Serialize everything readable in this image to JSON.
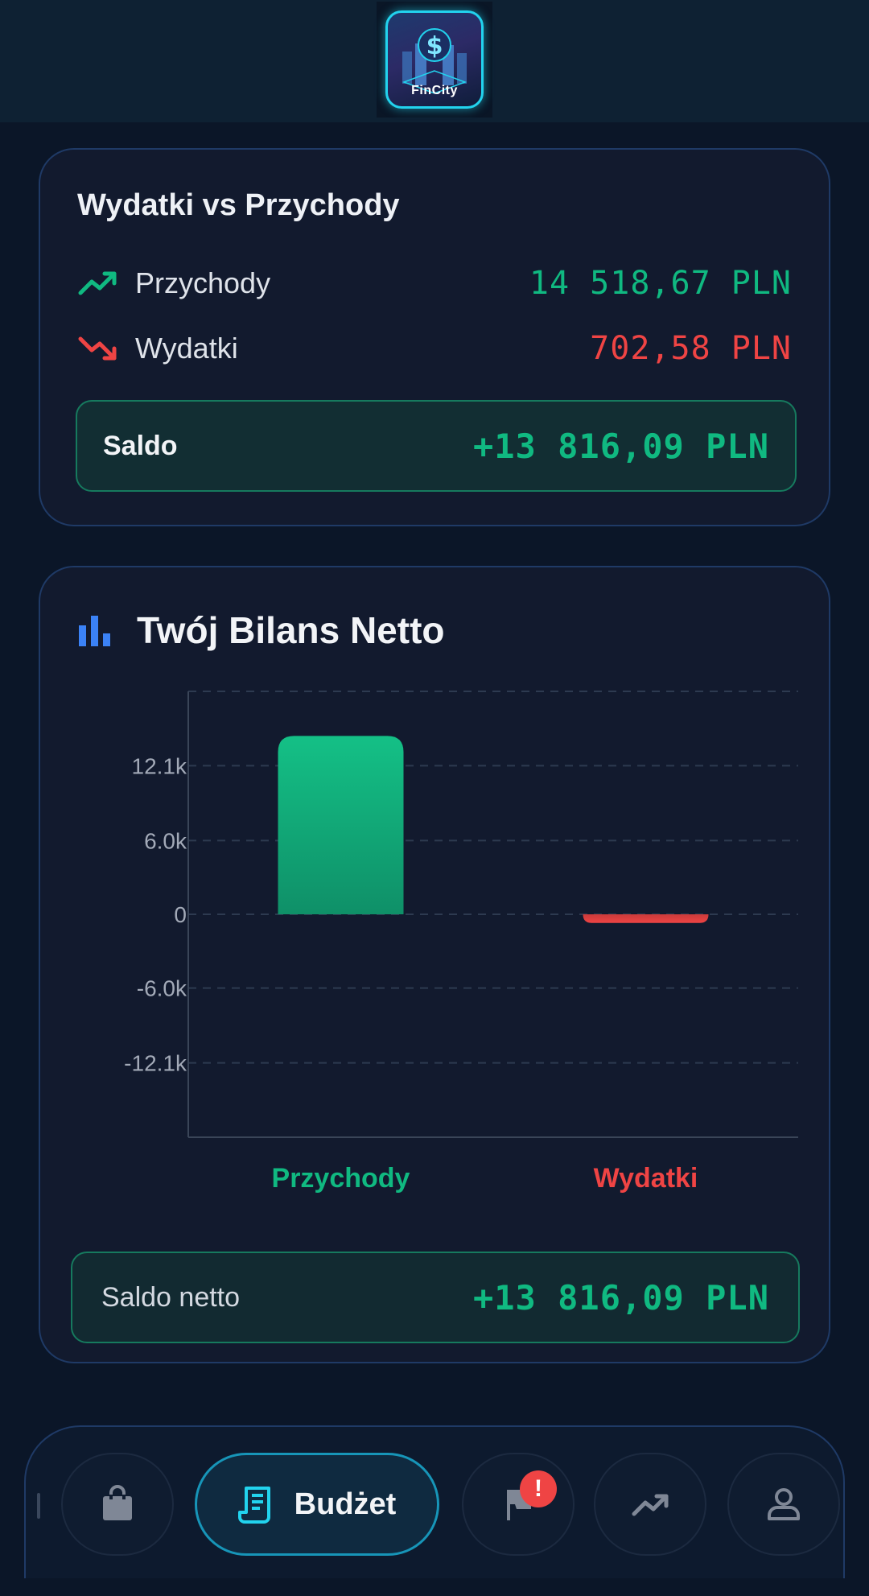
{
  "header": {
    "logo_text": "FinCity"
  },
  "summary": {
    "title": "Wydatki vs Przychody",
    "income_label": "Przychody",
    "income_amount": "14 518,67 PLN",
    "expense_label": "Wydatki",
    "expense_amount": "702,58 PLN",
    "balance_label": "Saldo",
    "balance_amount": "+13 816,09 PLN"
  },
  "net": {
    "title": "Twój Bilans Netto",
    "balance_label": "Saldo netto",
    "balance_amount": "+13 816,09 PLN"
  },
  "chart_data": {
    "type": "bar",
    "categories": [
      "Przychody",
      "Wydatki"
    ],
    "values": [
      14518.67,
      -702.58
    ],
    "colors": [
      "#10b981",
      "#ef4444"
    ],
    "yticks": [
      12100,
      6000,
      0,
      -6000,
      -12100
    ],
    "ytick_labels": [
      "12.1k",
      "6.0k",
      "0",
      "-6.0k",
      "-12.1k"
    ],
    "ylim": [
      -18150,
      18150
    ],
    "grid": true
  },
  "nav": {
    "active_label": "Budżet",
    "badge": "!",
    "icons": [
      "shopping-bag-icon",
      "receipt-icon",
      "flag-icon",
      "trending-up-icon",
      "user-icon"
    ]
  },
  "colors": {
    "income": "#10b981",
    "expense": "#ef4444",
    "accent": "#22d3ee",
    "card_bg": "#121a2e",
    "page_bg": "#0b1628"
  }
}
